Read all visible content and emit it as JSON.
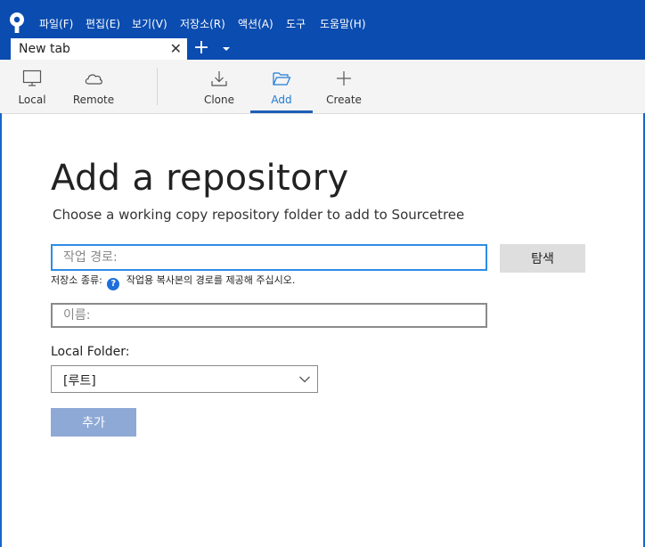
{
  "menu": [
    "파일(F)",
    "편집(E)",
    "보기(V)",
    "저장소(R)",
    "액션(A)",
    "도구",
    "도움말(H)"
  ],
  "tab": {
    "title": "New tab",
    "close": "✕",
    "add": "+"
  },
  "toolbar": {
    "local": "Local",
    "remote": "Remote",
    "clone": "Clone",
    "add": "Add",
    "create": "Create",
    "active": "Add"
  },
  "page": {
    "title": "Add a repository",
    "subtitle": "Choose a working copy repository folder to add to Sourcetree"
  },
  "form": {
    "path_placeholder": "작업 경로:",
    "browse_label": "탐색",
    "hint_prefix": "저장소 종류:",
    "hint_icon": "?",
    "hint_text": "작업용 복사본의 경로를 제공해 주십시오.",
    "name_placeholder": "이름:",
    "local_folder_label": "Local Folder:",
    "local_folder_value": "[루트]",
    "submit_label": "추가"
  },
  "colors": {
    "titlebar": "#0b4cb0",
    "accent": "#1e7ad6",
    "add_button": "#8fa9d6"
  }
}
